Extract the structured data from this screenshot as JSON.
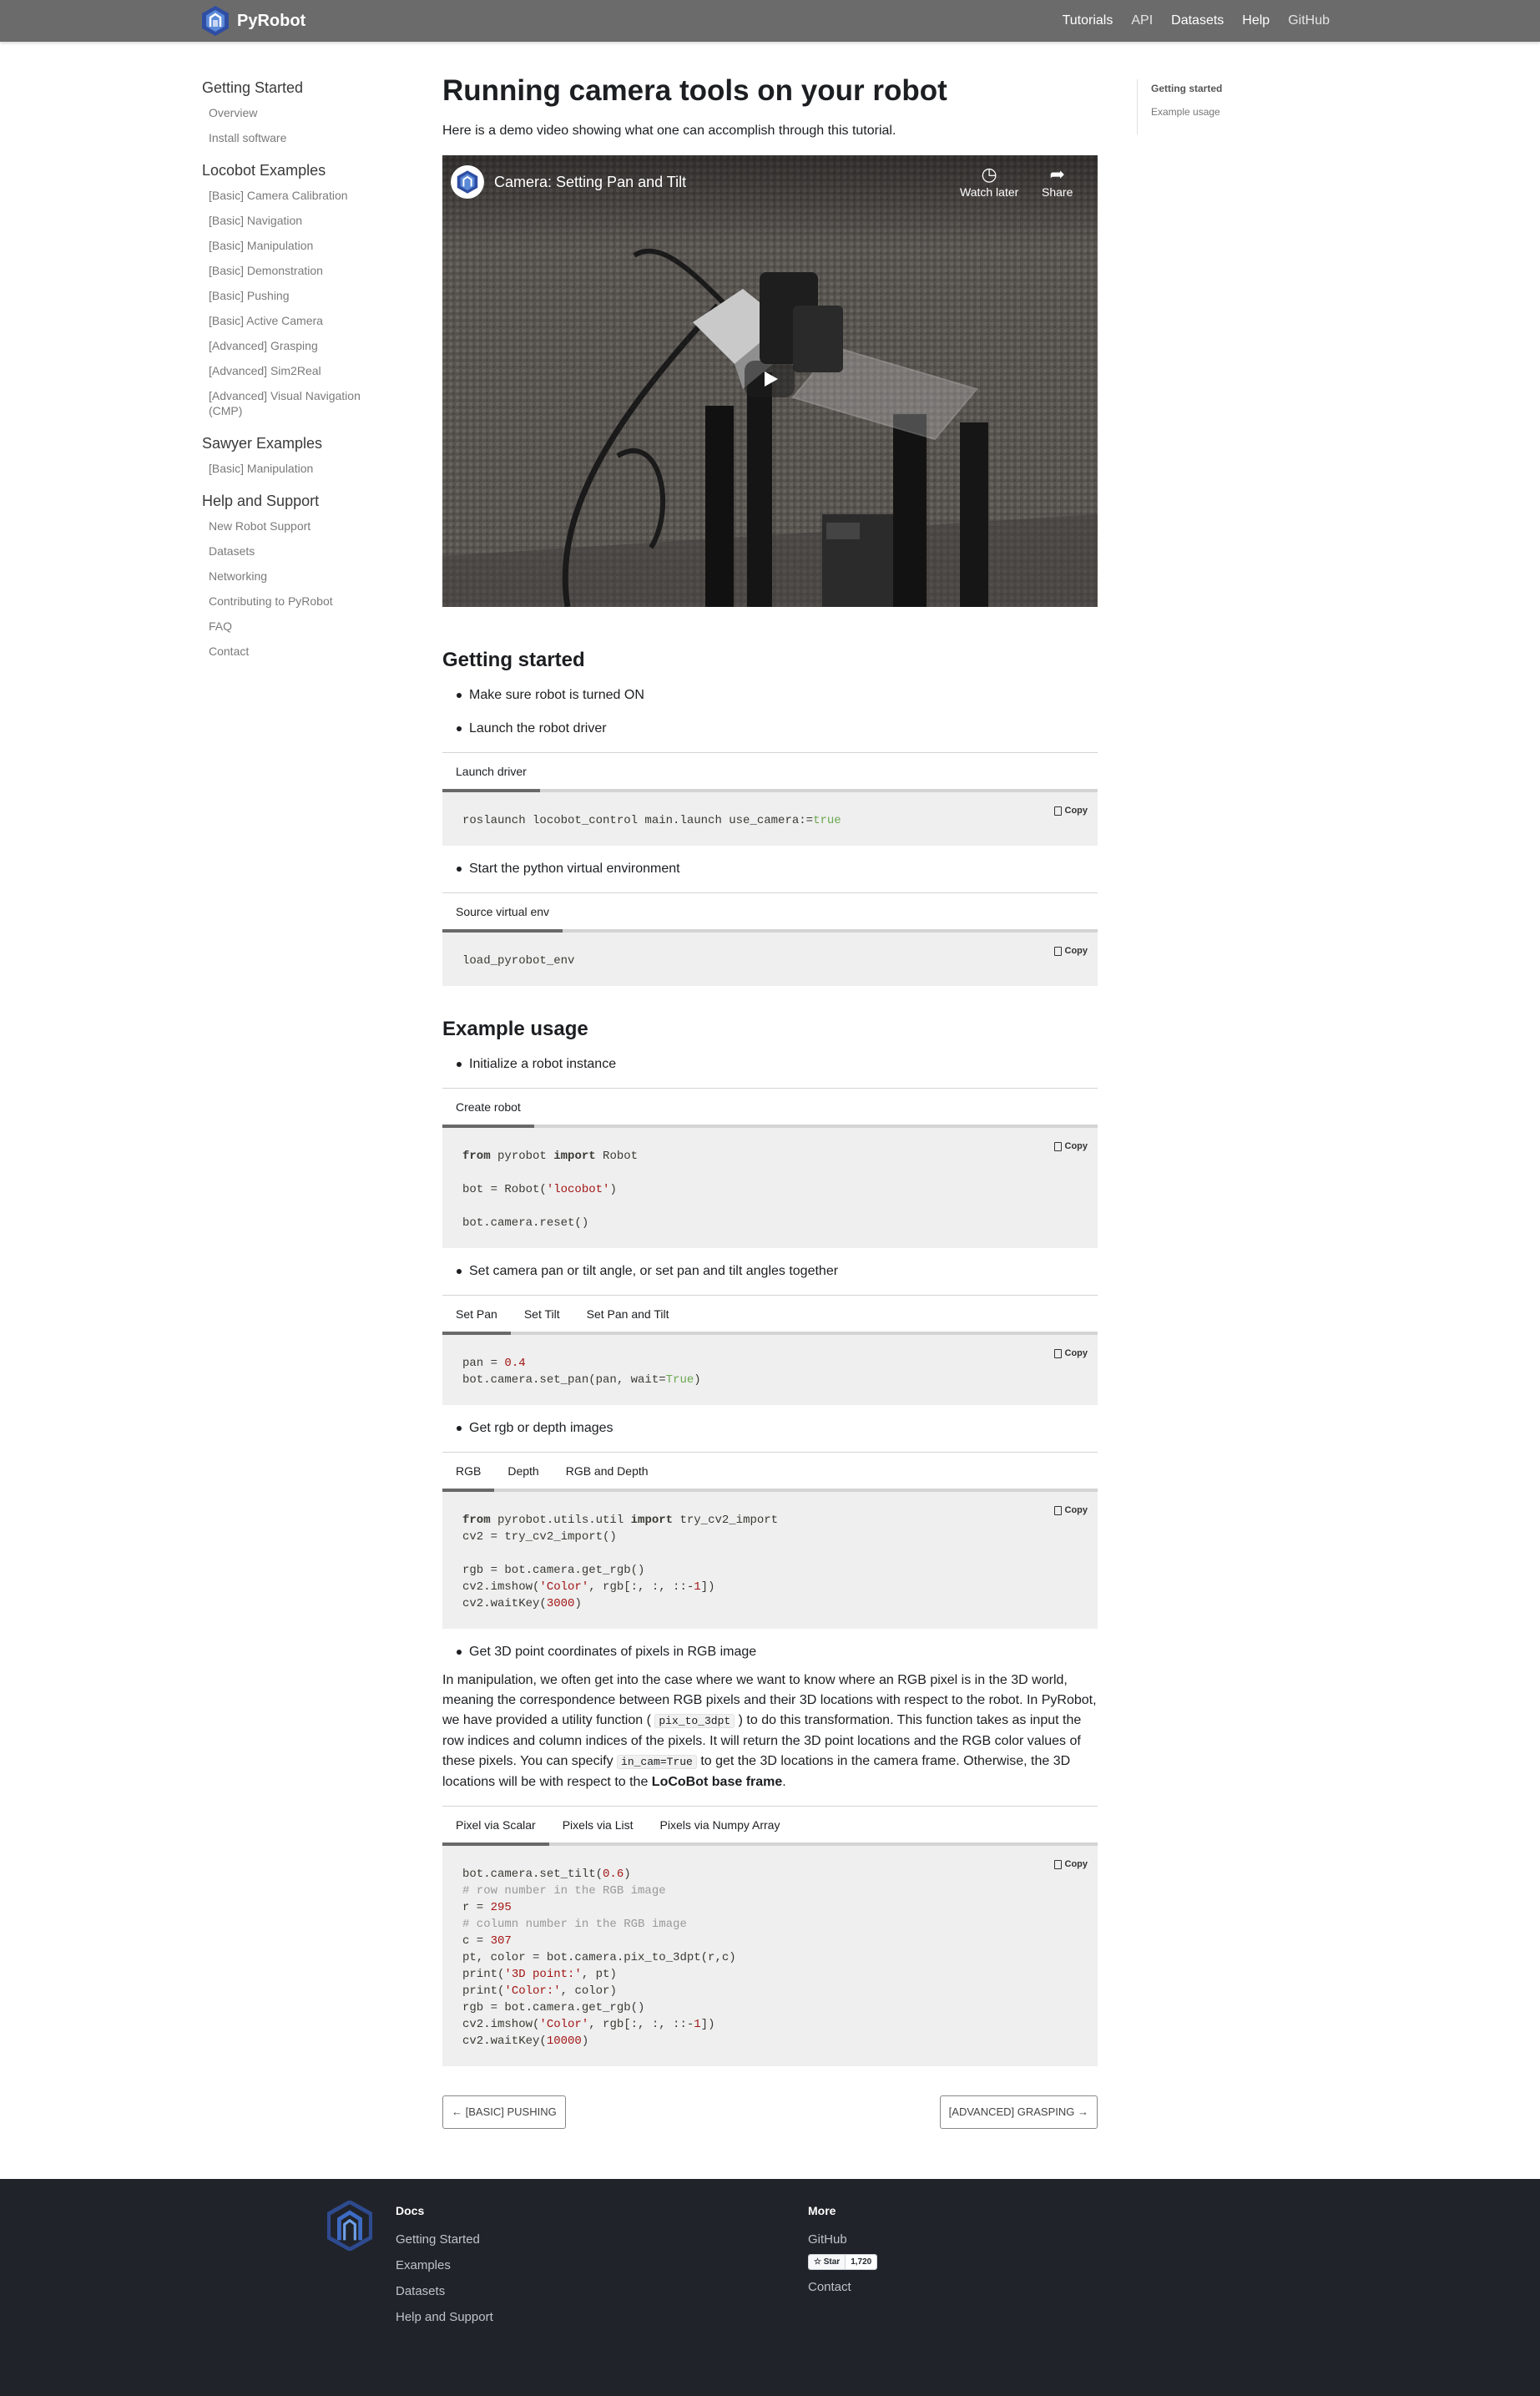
{
  "topnav": {
    "brand": "PyRobot",
    "links": [
      "Tutorials",
      "API",
      "Datasets",
      "Help",
      "GitHub"
    ]
  },
  "sidebar": {
    "groups": [
      {
        "title": "Getting Started",
        "items": [
          "Overview",
          "Install software"
        ]
      },
      {
        "title": "Locobot Examples",
        "items": [
          "[Basic] Camera Calibration",
          "[Basic] Navigation",
          "[Basic] Manipulation",
          "[Basic] Demonstration",
          "[Basic] Pushing",
          "[Basic] Active Camera",
          "[Advanced] Grasping",
          "[Advanced] Sim2Real",
          "[Advanced] Visual Navigation (CMP)"
        ]
      },
      {
        "title": "Sawyer Examples",
        "items": [
          "[Basic] Manipulation"
        ]
      },
      {
        "title": "Help and Support",
        "items": [
          "New Robot Support",
          "Datasets",
          "Networking",
          "Contributing to PyRobot",
          "FAQ",
          "Contact"
        ]
      }
    ]
  },
  "toc": {
    "items": [
      "Getting started",
      "Example usage"
    ]
  },
  "main": {
    "title": "Running camera tools on your robot",
    "intro": "Here is a demo video showing what one can accomplish through this tutorial.",
    "video": {
      "title": "Camera: Setting Pan and Tilt",
      "watch_later": "Watch later",
      "share": "Share"
    },
    "getting_started": {
      "heading": "Getting started",
      "b1": "Make sure robot is turned ON",
      "b2": "Launch the robot driver",
      "tab1": "Launch driver",
      "code1": "roslaunch locobot_control main.launch use_camera:=true",
      "b3": "Start the python virtual environment",
      "tab2": "Source virtual env",
      "code2": "load_pyrobot_env"
    },
    "example": {
      "heading": "Example usage",
      "b1": "Initialize a robot instance",
      "tab_create": "Create robot",
      "b2": "Set camera pan or tilt angle, or set pan and tilt angles together",
      "tabs_pan": [
        "Set Pan",
        "Set Tilt",
        "Set Pan and Tilt"
      ],
      "b3": "Get rgb or depth images",
      "tabs_rgb": [
        "RGB",
        "Depth",
        "RGB and Depth"
      ],
      "b4": "Get 3D point coordinates of pixels in RGB image",
      "para_1": "In manipulation, we often get into the case where we want to know where an RGB pixel is in the 3D world, meaning the correspondence between RGB pixels and their 3D locations with respect to the robot. In PyRobot, we have provided a utility function (",
      "para_code1": "pix_to_3dpt",
      "para_2": ") to do this transformation. This function takes as input the row indices and column indices of the pixels. It will return the 3D point locations and the RGB color values of these pixels. You can specify",
      "para_code2": "in_cam=True",
      "para_3": "to get the 3D locations in the camera frame. Otherwise, the 3D locations will be with respect to the",
      "para_bold": "LoCoBot base frame",
      "tabs_pix": [
        "Pixel via Scalar",
        "Pixels via List",
        "Pixels via Numpy Array"
      ]
    },
    "copy_label": "Copy",
    "prev": "← [BASIC] PUSHING",
    "next": "[ADVANCED] GRASPING →"
  },
  "footer": {
    "docs_heading": "Docs",
    "docs": [
      "Getting Started",
      "Examples",
      "Datasets",
      "Help and Support"
    ],
    "more_heading": "More",
    "github": "GitHub",
    "star": "Star",
    "star_count": "1,720",
    "contact": "Contact"
  },
  "colors": {
    "nav_bg": "#6b6b6b",
    "footer_bg": "#20232a",
    "code_bg": "#efefef",
    "string": "#a31515",
    "bool": "#6aa84f"
  }
}
